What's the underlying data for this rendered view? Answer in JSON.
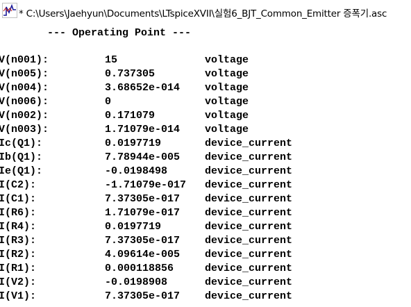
{
  "window": {
    "title": "* C:\\Users\\Jaehyun\\Documents\\LTspiceXVII\\실험6_BJT_Common_Emitter 증폭기.asc"
  },
  "output": {
    "header": "--- Operating Point ---",
    "rows": [
      {
        "name": "V(n001):",
        "value": "15",
        "type": "voltage"
      },
      {
        "name": "V(n005):",
        "value": "0.737305",
        "type": "voltage"
      },
      {
        "name": "V(n004):",
        "value": "3.68652e-014",
        "type": "voltage"
      },
      {
        "name": "V(n006):",
        "value": "0",
        "type": "voltage"
      },
      {
        "name": "V(n002):",
        "value": "0.171079",
        "type": "voltage"
      },
      {
        "name": "V(n003):",
        "value": "1.71079e-014",
        "type": "voltage"
      },
      {
        "name": "Ic(Q1):",
        "value": "0.0197719",
        "type": "device_current"
      },
      {
        "name": "Ib(Q1):",
        "value": "7.78944e-005",
        "type": "device_current"
      },
      {
        "name": "Ie(Q1):",
        "value": "-0.0198498",
        "type": "device_current"
      },
      {
        "name": "I(C2):",
        "value": "-1.71079e-017",
        "type": "device_current"
      },
      {
        "name": "I(C1):",
        "value": "7.37305e-017",
        "type": "device_current"
      },
      {
        "name": "I(R6):",
        "value": "1.71079e-017",
        "type": "device_current"
      },
      {
        "name": "I(R4):",
        "value": "0.0197719",
        "type": "device_current"
      },
      {
        "name": "I(R3):",
        "value": "7.37305e-017",
        "type": "device_current"
      },
      {
        "name": "I(R2):",
        "value": "4.09614e-005",
        "type": "device_current"
      },
      {
        "name": "I(R1):",
        "value": "0.000118856",
        "type": "device_current"
      },
      {
        "name": "I(V2):",
        "value": "-0.0198908",
        "type": "device_current"
      },
      {
        "name": "I(V1):",
        "value": "7.37305e-017",
        "type": "device_current"
      }
    ]
  }
}
